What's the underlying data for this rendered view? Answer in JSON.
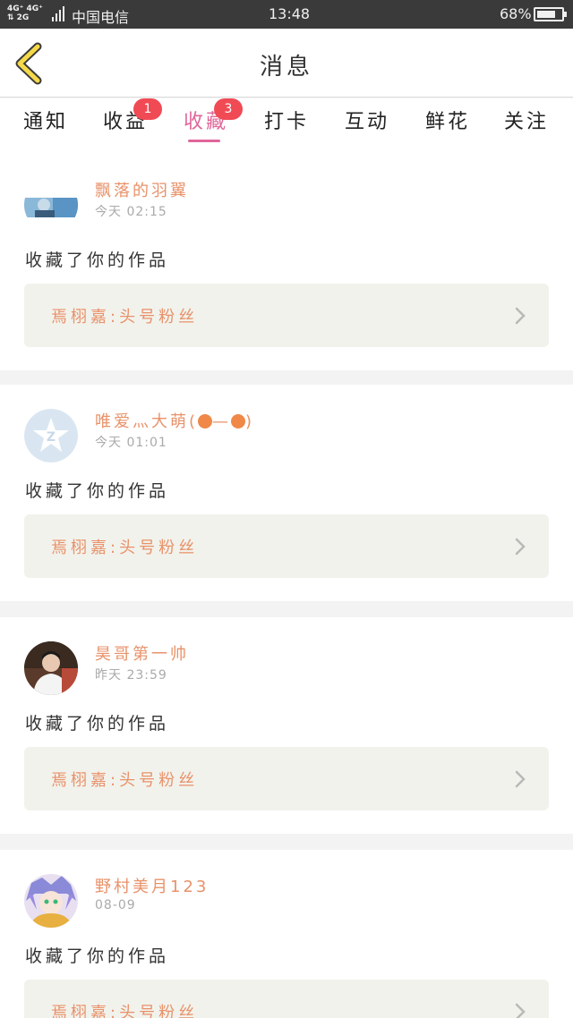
{
  "status_bar": {
    "network_line1": "4G⁺ 4G⁺",
    "network_line2": "⇅ 2G",
    "carrier": "中国电信",
    "time": "13:48",
    "battery": "68%"
  },
  "header": {
    "title": "消息"
  },
  "tabs": [
    {
      "label": "通知",
      "badge": ""
    },
    {
      "label": "收益",
      "badge": "1"
    },
    {
      "label": "收藏",
      "badge": "3",
      "active": true
    },
    {
      "label": "打卡",
      "badge": ""
    },
    {
      "label": "互动",
      "badge": ""
    },
    {
      "label": "鲜花",
      "badge": ""
    },
    {
      "label": "关注",
      "badge": ""
    }
  ],
  "messages": [
    {
      "name": "飘落的羽翼",
      "time": "今天 02:15",
      "action": "收藏了你的作品",
      "work": "焉栩嘉:头号粉丝"
    },
    {
      "name": "唯爱灬大萌(",
      "name_suffix": "—",
      "name_end": ")",
      "time": "今天 01:01",
      "action": "收藏了你的作品",
      "work": "焉栩嘉:头号粉丝"
    },
    {
      "name": "昊哥第一帅",
      "time": "昨天 23:59",
      "action": "收藏了你的作品",
      "work": "焉栩嘉:头号粉丝"
    },
    {
      "name": "野村美月123",
      "time": "08-09",
      "action": "收藏了你的作品",
      "work": "焉栩嘉:头号粉丝"
    }
  ],
  "colors": {
    "accent_pink": "#e0669a",
    "name_orange": "#e8926a",
    "badge_red": "#f04a55"
  }
}
